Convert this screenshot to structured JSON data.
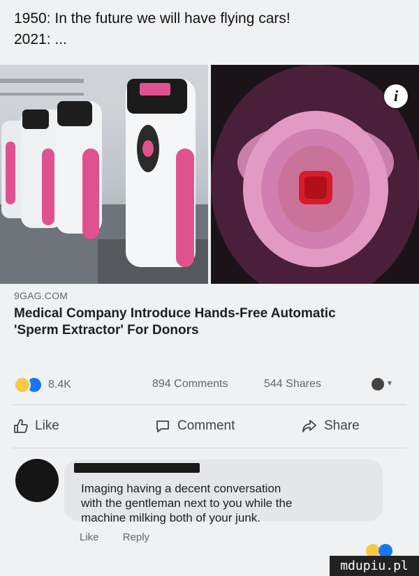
{
  "caption": {
    "line1": "1950: In the future we will have flying cars!",
    "line2": "2021: ..."
  },
  "post": {
    "image_left_description": "machines-photo",
    "image_right_description": "device-closeup-photo",
    "info_button": "i",
    "domain": "9GAG.COM",
    "headline_line1": "Medical Company Introduce Hands-Free Automatic",
    "headline_line2": "'Sperm Extractor' For Donors"
  },
  "stats": {
    "reactions_count": "8.4K",
    "comments": "894 Comments",
    "shares": "544 Shares"
  },
  "actions": {
    "like": "Like",
    "comment": "Comment",
    "share": "Share"
  },
  "comment": {
    "line1": "Imaging having a decent conversation",
    "line2": "with the gentleman next to you while the",
    "line3": "machine milking both of your junk.",
    "like": "Like",
    "reply": "Reply"
  },
  "watermark": "mdupiu.pl",
  "colors": {
    "page_bg": "#f0f1f3",
    "like_blue": "#1877f2",
    "haha_yellow": "#f7c948",
    "pink": "#e0528f",
    "bubble_bg": "#e4e6ea"
  },
  "icons": [
    "info-icon",
    "haha-reaction-icon",
    "like-reaction-icon",
    "audience-icon",
    "caret-down-icon",
    "thumbs-up-icon",
    "comment-icon",
    "share-icon"
  ]
}
